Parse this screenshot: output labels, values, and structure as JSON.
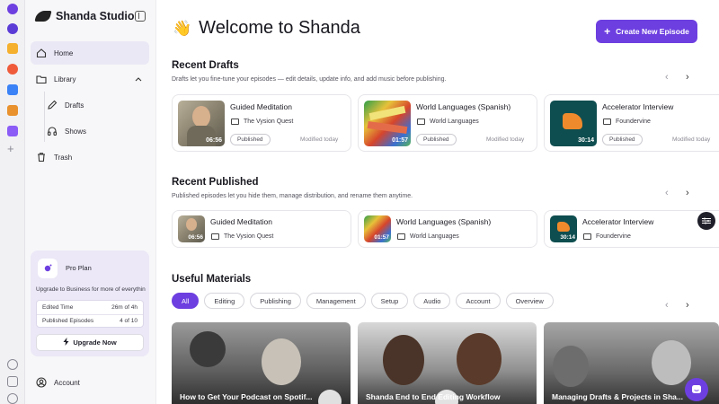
{
  "brand": {
    "name": "Shanda Studio"
  },
  "colors": {
    "accent": "#6d3fe0",
    "sidebar_bg": "#f7f7f9",
    "pro_card_bg": "#ece8f7"
  },
  "rail_icons": [
    "app-icon",
    "app-icon",
    "app-icon",
    "app-icon",
    "app-icon",
    "app-icon",
    "app-icon",
    "plus-icon",
    "gear-icon",
    "puzzle-icon",
    "history-icon"
  ],
  "sidebar": {
    "items": [
      {
        "label": "Home",
        "icon": "home-icon"
      },
      {
        "label": "Library",
        "icon": "folder-icon"
      },
      {
        "label": "Drafts",
        "icon": "pen-icon"
      },
      {
        "label": "Shows",
        "icon": "headphones-icon"
      },
      {
        "label": "Trash",
        "icon": "trash-icon"
      }
    ],
    "pro_plan": {
      "title": "Pro Plan",
      "description": "Upgrade to Business for more of everythin",
      "edited_time_label": "Edited Time",
      "edited_time_value": "26m of 4h",
      "published_label": "Published Episodes",
      "published_value": "4 of 10",
      "upgrade_label": "Upgrade Now"
    },
    "account_label": "Account"
  },
  "main": {
    "welcome": "Welcome to Shanda",
    "create_button": "Create New Episode",
    "drafts": {
      "title": "Recent Drafts",
      "description": "Drafts let you fine-tune your episodes — edit details, update info, and add music before publishing.",
      "cards": [
        {
          "title": "Guided Meditation",
          "show": "The Vysion Quest",
          "duration": "06:56",
          "status": "Published",
          "modified": "Modified today"
        },
        {
          "title": "World Languages (Spanish)",
          "show": "World Languages",
          "duration": "01:57",
          "status": "Published",
          "modified": "Modified today"
        },
        {
          "title": "Accelerator Interview",
          "show": "Foundervine",
          "duration": "30:14",
          "status": "Published",
          "modified": "Modified today"
        }
      ]
    },
    "published": {
      "title": "Recent Published",
      "description": "Published episodes let you hide them, manage distribution, and rename them anytime.",
      "cards": [
        {
          "title": "Guided Meditation",
          "show": "The Vysion Quest",
          "duration": "06:56"
        },
        {
          "title": "World Languages (Spanish)",
          "show": "World Languages",
          "duration": "01:57"
        },
        {
          "title": "Accelerator Interview",
          "show": "Foundervine",
          "duration": "30:14"
        }
      ]
    },
    "materials": {
      "title": "Useful Materials",
      "chips": [
        "All",
        "Editing",
        "Publishing",
        "Management",
        "Setup",
        "Audio",
        "Account",
        "Overview"
      ],
      "active_chip": "All",
      "videos": [
        {
          "title": "How to Get Your Podcast on Spotif..."
        },
        {
          "title": "Shanda End to End Editing Workflow"
        },
        {
          "title": "Managing Drafts & Projects in Sha..."
        }
      ]
    }
  }
}
